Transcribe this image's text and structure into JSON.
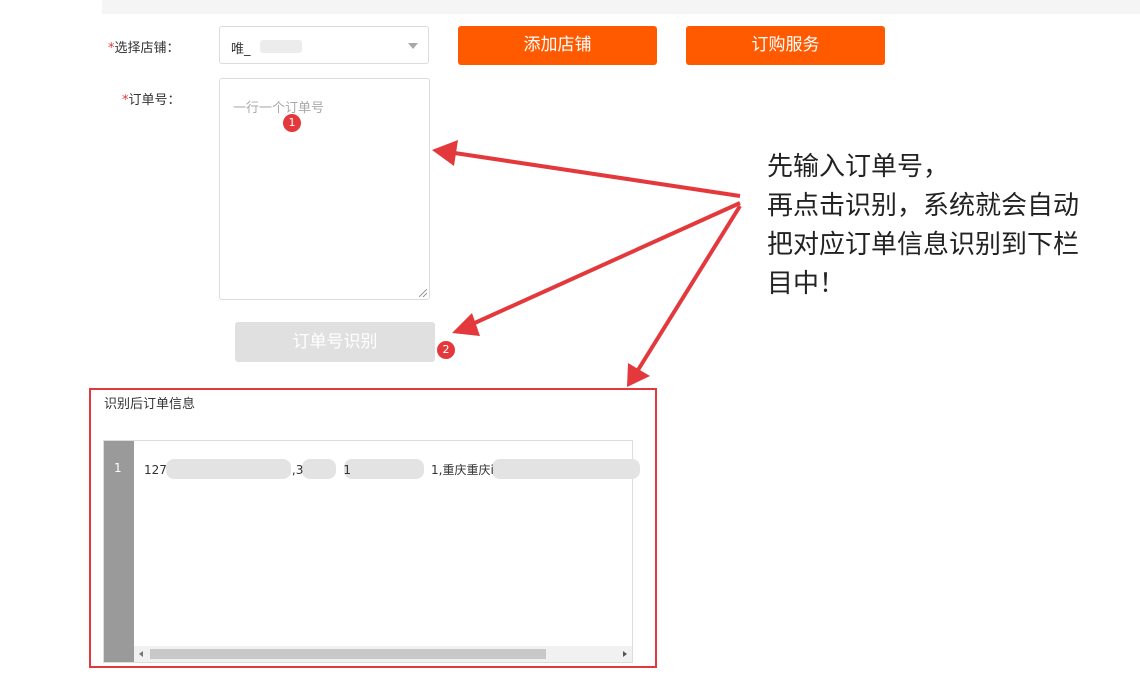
{
  "form": {
    "store_label": "选择店铺：",
    "store_value": "唯_",
    "add_store": "添加店铺",
    "subscribe": "订购服务",
    "order_label": "订单号：",
    "order_placeholder": "一行一个订单号",
    "recognize_btn": "订单号识别",
    "required_mark": "*"
  },
  "badges": {
    "step1": "1",
    "step2": "2"
  },
  "result": {
    "title": "识别后订单信息",
    "line_no": "1",
    "line_prefix": "127",
    "line_mid1": ",3",
    "line_mid2": "1",
    "line_mid3": "1,重庆重庆i"
  },
  "annotation": {
    "lines": [
      "先输入订单号，",
      "再点击识别，系统就会自动",
      "把对应订单信息识别到下栏",
      "目中！"
    ]
  },
  "colors": {
    "accent": "#ff5a00",
    "highlight": "#e4393c"
  }
}
